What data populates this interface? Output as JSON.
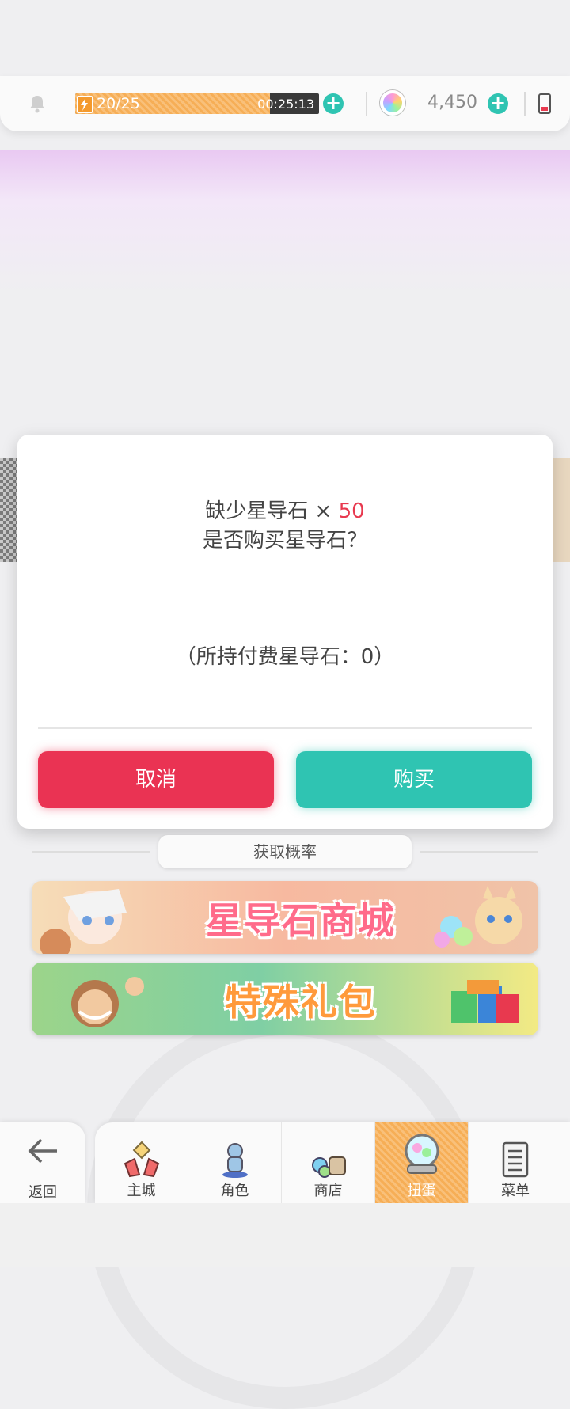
{
  "status_bar": {
    "stamina_text": "20/25",
    "stamina_fraction": 0.8,
    "timer": "00:25:13",
    "gem_count": "4,450",
    "plus_label": "+"
  },
  "dialog": {
    "line1_prefix": "缺少星导石 × ",
    "line1_qty": "50",
    "line2": "是否购买星导石？",
    "held_text": "（所持付费星导石：0）",
    "cancel_label": "取消",
    "buy_label": "购买"
  },
  "rates": {
    "label": "获取概率"
  },
  "banners": {
    "shop_title": "星导石商城",
    "pack_title": "特殊礼包"
  },
  "nav": {
    "back": "返回",
    "items": [
      "主城",
      "角色",
      "商店",
      "扭蛋",
      "菜单"
    ]
  },
  "colors": {
    "accent_red": "#ea3353",
    "accent_teal": "#2fc4b2",
    "accent_orange": "#f6ae56"
  }
}
